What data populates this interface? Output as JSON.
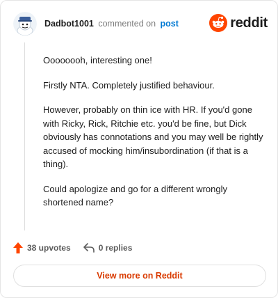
{
  "header": {
    "username": "Dadbot1001",
    "commented_text": "commented on",
    "post_link": "post",
    "brand": "reddit",
    "brand_color": "#ff4500",
    "avatar_icon": "dadbot-avatar-icon"
  },
  "comment": {
    "paragraphs": [
      "Oooooooh, interesting one!",
      "Firstly NTA. Completely justified behaviour.",
      "However, probably on thin ice with HR. If you'd gone with Ricky, Rick, Ritchie etc. you'd be fine, but Dick obviously has connotations and you may well be rightly accused of mocking him/insubordination (if that is a thing).",
      "Could apologize and go for a different wrongly shortened name?"
    ]
  },
  "actions": {
    "upvotes": "38 upvotes",
    "replies": "0 replies",
    "upvote_color": "#ff4500"
  },
  "footer": {
    "view_more": "View more on Reddit",
    "view_more_color": "#d93a00"
  }
}
